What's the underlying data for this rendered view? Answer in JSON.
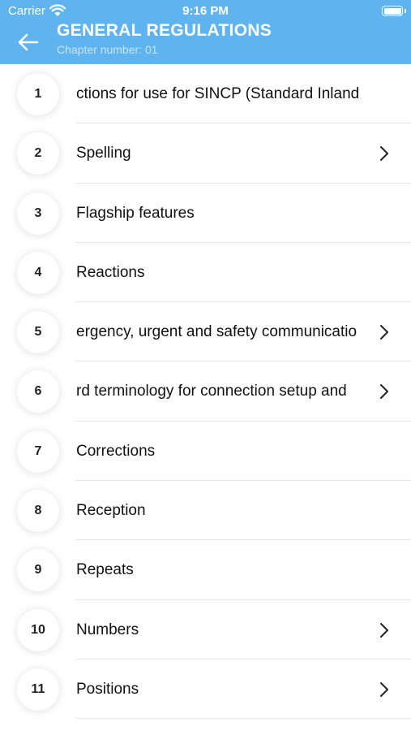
{
  "status_bar": {
    "carrier": "Carrier",
    "time": "9:16 PM"
  },
  "header": {
    "title": "GENERAL REGULATIONS",
    "subtitle": "Chapter number: 01"
  },
  "items": [
    {
      "number": "1",
      "label": "ctions for use for SINCP (Standard Inland",
      "has_chevron": false
    },
    {
      "number": "2",
      "label": "Spelling",
      "has_chevron": true
    },
    {
      "number": "3",
      "label": "Flagship features",
      "has_chevron": false
    },
    {
      "number": "4",
      "label": "Reactions",
      "has_chevron": false
    },
    {
      "number": "5",
      "label": "ergency, urgent and safety communicatio",
      "has_chevron": true
    },
    {
      "number": "6",
      "label": "rd terminology for connection setup and",
      "has_chevron": true
    },
    {
      "number": "7",
      "label": "Corrections",
      "has_chevron": false
    },
    {
      "number": "8",
      "label": "Reception",
      "has_chevron": false
    },
    {
      "number": "9",
      "label": "Repeats",
      "has_chevron": false
    },
    {
      "number": "10",
      "label": "Numbers",
      "has_chevron": true
    },
    {
      "number": "11",
      "label": "Positions",
      "has_chevron": true
    }
  ],
  "colors": {
    "header_bg": "#5fb4f0",
    "text": "#111111",
    "divider": "#e6e6e6"
  }
}
